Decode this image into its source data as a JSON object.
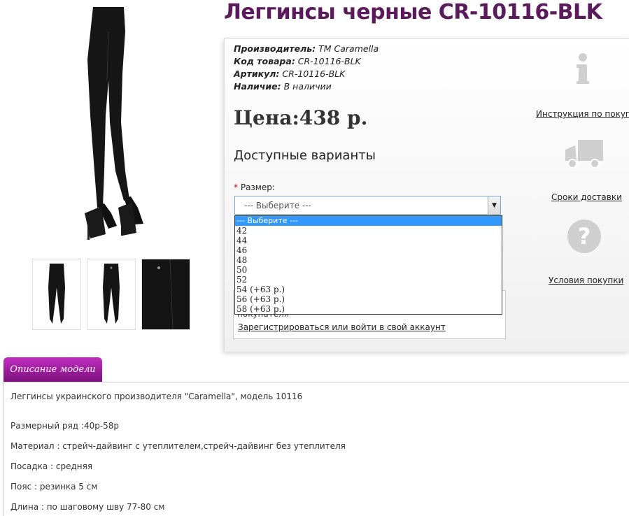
{
  "product": {
    "title": "Леггинсы черные CR-10116-BLK",
    "meta": {
      "manufacturer_label": "Производитель:",
      "manufacturer": "TM Caramella",
      "code_label": "Код товара:",
      "code": "CR-10116-BLK",
      "article_label": "Артикул:",
      "article": "CR-10116-BLK",
      "availability_label": "Наличие:",
      "availability": "В наличии"
    },
    "price": "Цена:438 р.",
    "variants_title": "Доступные варианты",
    "size": {
      "required_mark": "*",
      "label": "Размер:",
      "selected": "--- Выберите ---",
      "options": [
        "--- Выберите ---",
        "42",
        "44",
        "46",
        "48",
        "50",
        "52",
        "54 (+63 р.)",
        "56 (+63 р.)",
        "58 (+63 р.)"
      ]
    },
    "login_hidden_text": "покупателя",
    "login_link": "Зарегистрироваться или войти в свой аккаунт"
  },
  "side": {
    "instruction": "Инструкция по покупке",
    "delivery": "Сроки доставки",
    "conditions": "Условия покупки"
  },
  "tabs": {
    "description": "Описание модели"
  },
  "description": {
    "line1": "Леггинсы украинского производителя \"Caramella\", модель 10116",
    "line2": "Размерный ряд :40р-58р",
    "line3": "Материал : стрейч-дайвинг с утеплителем,стрейч-дайвинг без утеплителя",
    "line4": "Посадка : средняя",
    "line5": "Пояс : резинка 5 см",
    "line6": "Длина : по шаговому шву 77-80 см"
  },
  "colors": {
    "title": "#5a1a5c",
    "tab": "#a020a0",
    "select_highlight": "#3399ff"
  }
}
